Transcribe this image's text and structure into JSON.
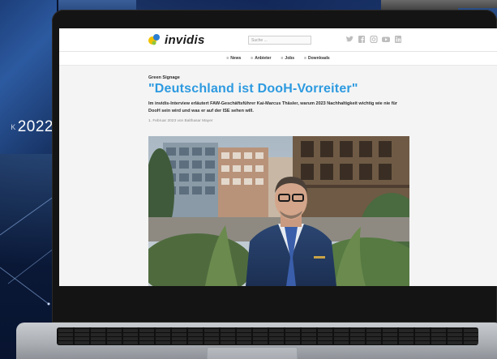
{
  "background": {
    "year_prefix": "K",
    "year": "2022"
  },
  "site": {
    "logo_text": "invidis",
    "search_placeholder": "Suche ...",
    "social_icons": [
      "twitter-icon",
      "facebook-icon",
      "instagram-icon",
      "youtube-icon",
      "linkedin-icon"
    ],
    "nav": [
      {
        "label": "News"
      },
      {
        "label": "Anbieter"
      },
      {
        "label": "Jobs"
      },
      {
        "label": "Downloads"
      }
    ]
  },
  "article": {
    "kicker": "Green Signage",
    "headline": "\"Deutschland ist DooH-Vorreiter\"",
    "lead": "Im invidis-Interview erläutert FAW-Geschäftsführer Kai-Marcus Thäsler, warum 2023 Nachhaltigkeit wichtig wie nie für DooH sein wird und was er auf der ISE sehen will.",
    "byline": "1. Februar 2023 von Balthasar Mayer"
  },
  "colors": {
    "headline": "#2d9ae0",
    "logo_accent_yellow": "#f2c200",
    "logo_accent_blue": "#2d7fd1"
  }
}
